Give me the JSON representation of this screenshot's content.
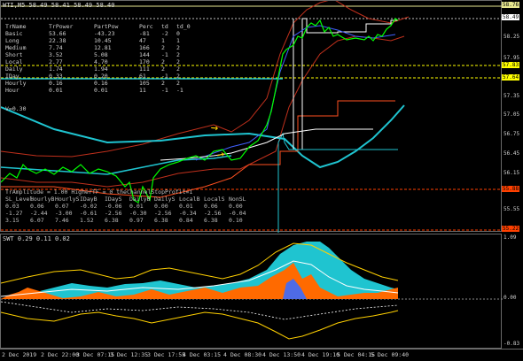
{
  "main": {
    "title": "WTI,M5  58.49 58.41 58.49 58.40",
    "dashboard": {
      "headers": [
        "TrName",
        "TrPower",
        "PartPow",
        "Perc",
        "td",
        "td_0"
      ],
      "rows": [
        [
          "Basic",
          "53.66",
          "-43.23",
          "-81",
          "-2",
          "0"
        ],
        [
          "Long",
          "22.38",
          "10.45",
          "47",
          "1",
          "1"
        ],
        [
          "Medium",
          "7.74",
          "12.81",
          "166",
          "2",
          "2"
        ],
        [
          "Short",
          "3.52",
          "5.08",
          "144",
          "-1",
          "2"
        ],
        [
          "Local",
          "2.77",
          "4.70",
          "170",
          "2",
          "2"
        ],
        [
          "Daily",
          "1.74",
          "1.94",
          "111",
          "2",
          "2"
        ],
        [
          "IDay",
          "0.33",
          "0.20",
          "61",
          "-1",
          "2"
        ],
        [
          "Hourly",
          "0.16",
          "0.16",
          "105",
          "2",
          "2"
        ],
        [
          "Hour",
          "0.01",
          "0.01",
          "11",
          "-1",
          "-1"
        ]
      ],
      "vline": "V=0.30"
    },
    "stop_header": "TrAmplitude = 1.00     HigherTF = 0     theChannelStopProfit=1",
    "sl_headers": [
      "SL_Level",
      "HourlyB",
      "HourlyS",
      "IDayB",
      "IDayS",
      "DailyB",
      "DailyS",
      "LocalB",
      "LocalS",
      "NonSL"
    ],
    "sl_rows": [
      [
        "0.03",
        "0.06",
        "0.07",
        "-0.02",
        "-0.06",
        "0.01",
        "0.00",
        "0.01",
        "0.06",
        "0.00"
      ],
      [
        "-1.27",
        "-2.44",
        "-3.00",
        "-0.61",
        "-2.56",
        "-0.30",
        "-2.56",
        "-0.34",
        "-2.56",
        "-0.04"
      ],
      [
        "3.15",
        "6.07",
        "7.46",
        "1.52",
        "6.38",
        "0.97",
        "6.38",
        "0.84",
        "6.38",
        "0.10"
      ]
    ],
    "price_axis": [
      "58.76",
      "58.49",
      "58.25",
      "57.95",
      "57.83",
      "57.64",
      "57.35",
      "57.05",
      "56.75",
      "56.45",
      "56.15",
      "55.88",
      "55.55",
      "55.22"
    ],
    "boxed_prices": {
      "58.76": "#e8e890",
      "58.49": "#ffffff",
      "57.83": "#ffff00",
      "57.64": "#ffff00",
      "55.88": "#ff4000",
      "55.22": "#ff4000"
    }
  },
  "sub": {
    "title": "SWT 0.29 0.11 0.02",
    "axis": [
      "1.09",
      "0.00",
      "-0.83"
    ]
  },
  "time_axis": [
    "2 Dec 2019",
    "2 Dec 22:00",
    "3 Dec 07:15",
    "3 Dec 12:35",
    "3 Dec 17:55",
    "4 Dec 03:15",
    "4 Dec 08:30",
    "4 Dec 13:50",
    "4 Dec 19:10",
    "5 Dec 04:15",
    "5 Dec 09:40"
  ],
  "colors": {
    "price": "#00ff00",
    "ma_cyan": "#1fc4d0",
    "envelope": "#c0301c",
    "stop": "#ff5020",
    "blue_line": "#4060ff",
    "yellow": "#ffd000"
  }
}
